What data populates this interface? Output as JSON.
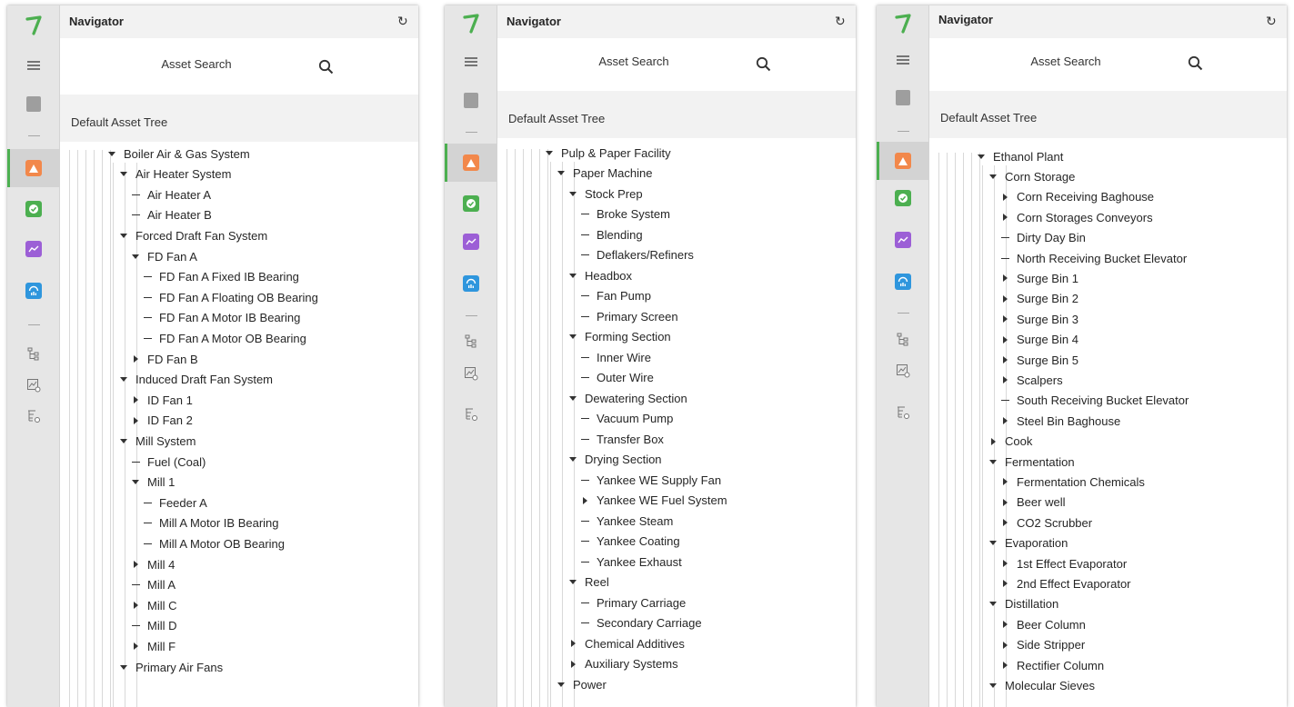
{
  "navigator": {
    "title": "Navigator",
    "search_label": "Asset Search",
    "tree_header": "Default Asset Tree"
  },
  "icons": {
    "logo": "logo-icon",
    "menu": "hamburger-icon",
    "asset_tree": "asset-tree-icon",
    "alerts": "alert-icon",
    "status": "status-check-icon",
    "trends": "trend-icon",
    "dashboard": "dashboard-gauge-icon",
    "hierarchy": "hierarchy-icon",
    "chart_settings": "chart-settings-icon",
    "tree_settings": "tree-settings-icon",
    "refresh": "refresh-icon",
    "search": "search-icon"
  },
  "colors": {
    "logo_green": "#4caf50",
    "alert_orange": "#f2884b",
    "status_green": "#4caf50",
    "trend_purple": "#9c5fd6",
    "dashboard_blue": "#2f96dd",
    "rail_background": "#e6e6e6",
    "header_background": "#f2f2f2"
  },
  "panels": [
    {
      "id": "boiler",
      "tree": [
        {
          "label": "Boiler Air & Gas System",
          "depth": 0,
          "toggle": "expanded"
        },
        {
          "label": "Air Heater System",
          "depth": 1,
          "toggle": "expanded"
        },
        {
          "label": "Air Heater A",
          "depth": 2,
          "toggle": "leaf"
        },
        {
          "label": "Air Heater B",
          "depth": 2,
          "toggle": "leaf"
        },
        {
          "label": "Forced Draft Fan System",
          "depth": 1,
          "toggle": "expanded"
        },
        {
          "label": "FD Fan A",
          "depth": 2,
          "toggle": "expanded"
        },
        {
          "label": "FD Fan A Fixed IB Bearing",
          "depth": 3,
          "toggle": "leaf"
        },
        {
          "label": "FD Fan A Floating OB Bearing",
          "depth": 3,
          "toggle": "leaf"
        },
        {
          "label": "FD Fan A Motor IB Bearing",
          "depth": 3,
          "toggle": "leaf"
        },
        {
          "label": "FD Fan A Motor OB Bearing",
          "depth": 3,
          "toggle": "leaf"
        },
        {
          "label": "FD Fan B",
          "depth": 2,
          "toggle": "collapsed"
        },
        {
          "label": "Induced Draft Fan System",
          "depth": 1,
          "toggle": "expanded"
        },
        {
          "label": "ID Fan 1",
          "depth": 2,
          "toggle": "collapsed"
        },
        {
          "label": "ID Fan 2",
          "depth": 2,
          "toggle": "collapsed"
        },
        {
          "label": "Mill System",
          "depth": 1,
          "toggle": "expanded"
        },
        {
          "label": "Fuel (Coal)",
          "depth": 2,
          "toggle": "leaf"
        },
        {
          "label": "Mill 1",
          "depth": 2,
          "toggle": "expanded"
        },
        {
          "label": "Feeder A",
          "depth": 3,
          "toggle": "leaf"
        },
        {
          "label": "Mill A Motor IB Bearing",
          "depth": 3,
          "toggle": "leaf"
        },
        {
          "label": "Mill A Motor OB Bearing",
          "depth": 3,
          "toggle": "leaf"
        },
        {
          "label": "Mill 4",
          "depth": 2,
          "toggle": "collapsed"
        },
        {
          "label": "Mill A",
          "depth": 2,
          "toggle": "leaf"
        },
        {
          "label": "Mill C",
          "depth": 2,
          "toggle": "collapsed"
        },
        {
          "label": "Mill D",
          "depth": 2,
          "toggle": "leaf"
        },
        {
          "label": "Mill F",
          "depth": 2,
          "toggle": "collapsed"
        },
        {
          "label": "Primary Air Fans",
          "depth": 1,
          "toggle": "expanded"
        }
      ]
    },
    {
      "id": "pulp",
      "tree": [
        {
          "label": "Pulp & Paper Facility",
          "depth": 0,
          "toggle": "expanded"
        },
        {
          "label": "Paper Machine",
          "depth": 1,
          "toggle": "expanded"
        },
        {
          "label": "Stock Prep",
          "depth": 2,
          "toggle": "expanded"
        },
        {
          "label": "Broke System",
          "depth": 3,
          "toggle": "leaf"
        },
        {
          "label": "Blending",
          "depth": 3,
          "toggle": "leaf"
        },
        {
          "label": "Deflakers/Refiners",
          "depth": 3,
          "toggle": "leaf"
        },
        {
          "label": "Headbox",
          "depth": 2,
          "toggle": "expanded"
        },
        {
          "label": "Fan Pump",
          "depth": 3,
          "toggle": "leaf"
        },
        {
          "label": "Primary Screen",
          "depth": 3,
          "toggle": "leaf"
        },
        {
          "label": "Forming Section",
          "depth": 2,
          "toggle": "expanded"
        },
        {
          "label": "Inner Wire",
          "depth": 3,
          "toggle": "leaf"
        },
        {
          "label": "Outer Wire",
          "depth": 3,
          "toggle": "leaf"
        },
        {
          "label": "Dewatering Section",
          "depth": 2,
          "toggle": "expanded"
        },
        {
          "label": "Vacuum Pump",
          "depth": 3,
          "toggle": "leaf"
        },
        {
          "label": "Transfer Box",
          "depth": 3,
          "toggle": "leaf"
        },
        {
          "label": "Drying Section",
          "depth": 2,
          "toggle": "expanded"
        },
        {
          "label": "Yankee WE Supply Fan",
          "depth": 3,
          "toggle": "leaf"
        },
        {
          "label": "Yankee WE Fuel System",
          "depth": 3,
          "toggle": "collapsed"
        },
        {
          "label": "Yankee Steam",
          "depth": 3,
          "toggle": "leaf"
        },
        {
          "label": "Yankee Coating",
          "depth": 3,
          "toggle": "leaf"
        },
        {
          "label": "Yankee Exhaust",
          "depth": 3,
          "toggle": "leaf"
        },
        {
          "label": "Reel",
          "depth": 2,
          "toggle": "expanded"
        },
        {
          "label": "Primary Carriage",
          "depth": 3,
          "toggle": "leaf"
        },
        {
          "label": "Secondary Carriage",
          "depth": 3,
          "toggle": "leaf"
        },
        {
          "label": "Chemical Additives",
          "depth": 2,
          "toggle": "collapsed"
        },
        {
          "label": "Auxiliary Systems",
          "depth": 2,
          "toggle": "collapsed"
        },
        {
          "label": "Power",
          "depth": 1,
          "toggle": "expanded"
        }
      ]
    },
    {
      "id": "ethanol",
      "tree": [
        {
          "label": "Ethanol Plant",
          "depth": 0,
          "toggle": "expanded"
        },
        {
          "label": "Corn Storage",
          "depth": 1,
          "toggle": "expanded"
        },
        {
          "label": "Corn Receiving Baghouse",
          "depth": 2,
          "toggle": "collapsed"
        },
        {
          "label": "Corn Storages Conveyors",
          "depth": 2,
          "toggle": "collapsed"
        },
        {
          "label": "Dirty Day Bin",
          "depth": 2,
          "toggle": "leaf"
        },
        {
          "label": "North Receiving Bucket Elevator",
          "depth": 2,
          "toggle": "leaf"
        },
        {
          "label": "Surge Bin 1",
          "depth": 2,
          "toggle": "collapsed"
        },
        {
          "label": "Surge Bin 2",
          "depth": 2,
          "toggle": "collapsed"
        },
        {
          "label": "Surge Bin 3",
          "depth": 2,
          "toggle": "collapsed"
        },
        {
          "label": "Surge Bin 4",
          "depth": 2,
          "toggle": "collapsed"
        },
        {
          "label": "Surge Bin 5",
          "depth": 2,
          "toggle": "collapsed"
        },
        {
          "label": "Scalpers",
          "depth": 2,
          "toggle": "collapsed"
        },
        {
          "label": "South Receiving Bucket Elevator",
          "depth": 2,
          "toggle": "leaf"
        },
        {
          "label": "Steel Bin Baghouse",
          "depth": 2,
          "toggle": "collapsed"
        },
        {
          "label": "Cook",
          "depth": 1,
          "toggle": "collapsed"
        },
        {
          "label": "Fermentation",
          "depth": 1,
          "toggle": "expanded"
        },
        {
          "label": "Fermentation Chemicals",
          "depth": 2,
          "toggle": "collapsed"
        },
        {
          "label": "Beer well",
          "depth": 2,
          "toggle": "collapsed"
        },
        {
          "label": "CO2 Scrubber",
          "depth": 2,
          "toggle": "collapsed"
        },
        {
          "label": "Evaporation",
          "depth": 1,
          "toggle": "expanded"
        },
        {
          "label": "1st Effect Evaporator",
          "depth": 2,
          "toggle": "collapsed"
        },
        {
          "label": "2nd Effect Evaporator",
          "depth": 2,
          "toggle": "collapsed"
        },
        {
          "label": "Distillation",
          "depth": 1,
          "toggle": "expanded"
        },
        {
          "label": "Beer Column",
          "depth": 2,
          "toggle": "collapsed"
        },
        {
          "label": "Side Stripper",
          "depth": 2,
          "toggle": "collapsed"
        },
        {
          "label": "Rectifier Column",
          "depth": 2,
          "toggle": "collapsed"
        },
        {
          "label": "Molecular Sieves",
          "depth": 1,
          "toggle": "expanded"
        }
      ]
    }
  ]
}
